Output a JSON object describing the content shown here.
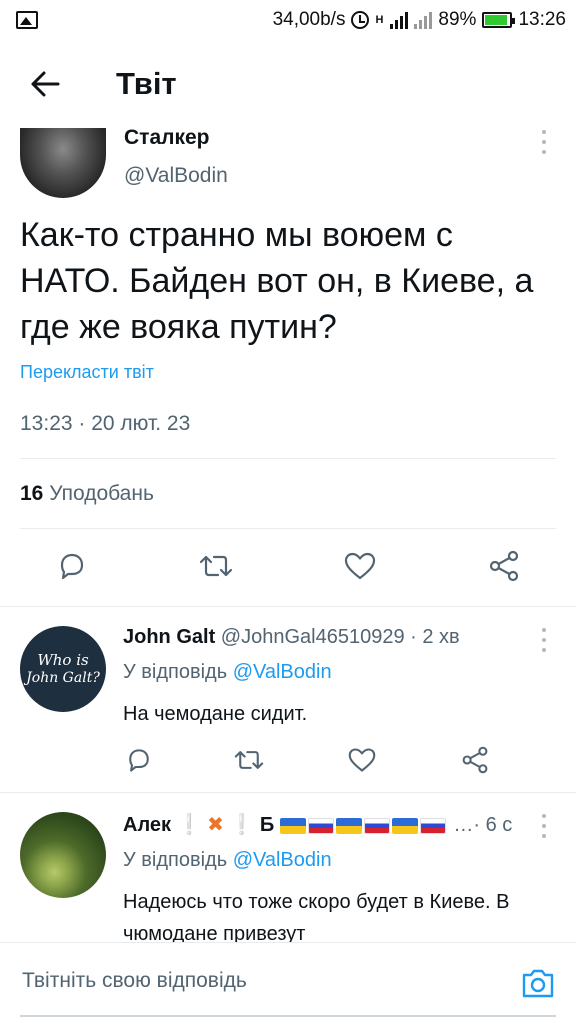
{
  "status_bar": {
    "speed": "34,00b/s",
    "network_type": "H",
    "battery_percent": "89%",
    "time": "13:26",
    "battery_level": 0.89
  },
  "header": {
    "title": "Твіт"
  },
  "tweet": {
    "author_name": "Сталкер",
    "author_handle": "@ValBodin",
    "text": "Как-то странно мы воюем с НАТО. Байден вот он, в Киеве, а где же вояка путин?",
    "translate_link": "Перекласти твіт",
    "timestamp": "13:23 · 20 лют. 23",
    "likes_count": "16",
    "likes_label": "Уподобань"
  },
  "replies": [
    {
      "author_name": "John Galt",
      "author_meta": "@JohnGal46510929 · 2 хв",
      "avatar_text_1": "Who is",
      "avatar_text_2": "John Galt?",
      "reply_to_label": "У відповідь",
      "reply_to_mention": "@ValBodin",
      "text": "На чемодане сидит."
    },
    {
      "author_name_prefix": "Алек",
      "author_name_mid": "Б",
      "author_meta": "…· 6 с",
      "reply_to_label": "У відповідь",
      "reply_to_mention": "@ValBodin",
      "text": "Надеюсь что тоже скоро будет в Киеве. В чюмодане привезут"
    }
  ],
  "composer": {
    "placeholder": "Твітніть свою відповідь"
  },
  "icons": {
    "back": "arrow-left-icon",
    "more": "more-vertical-icon",
    "reply": "reply-icon",
    "retweet": "retweet-icon",
    "like": "heart-icon",
    "share": "share-icon",
    "camera": "camera-icon"
  },
  "colors": {
    "accent": "#1d9bf0",
    "secondary_text": "#536471",
    "divider": "#e6ecf0",
    "battery": "#32c832"
  }
}
